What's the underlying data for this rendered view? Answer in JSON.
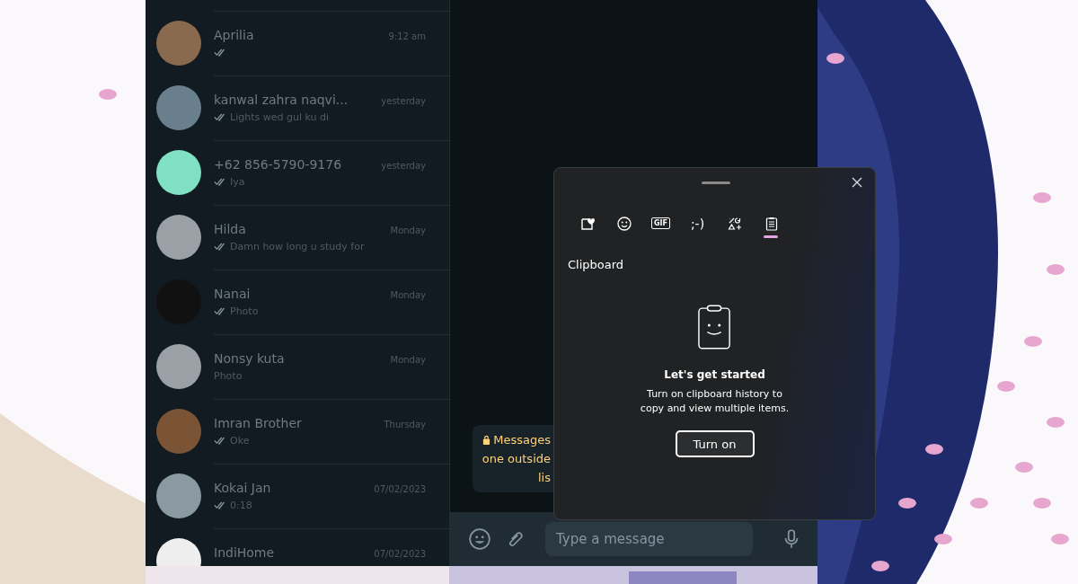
{
  "chats": [
    {
      "name": "Aprilia",
      "time": "9:12 am",
      "ticks": true,
      "color": "#8a6a4e"
    },
    {
      "name": "kanwal zahra naqvi...",
      "time": "yesterday",
      "preview": "Lights wed gul ku di",
      "ticks": true,
      "color": "#6a7f8e"
    },
    {
      "name": "+62 856-5790-9176",
      "time": "yesterday",
      "preview": "Iya",
      "ticks": true,
      "color": "#7fe0c4"
    },
    {
      "name": "Hilda",
      "time": "Monday",
      "preview": "Damn how long u study for",
      "ticks": true,
      "color": "#9aa0a6"
    },
    {
      "name": "Nanai",
      "time": "Monday",
      "preview": "Photo",
      "ticks": true,
      "color": "#111111"
    },
    {
      "name": "Nonsy kuta",
      "time": "Monday",
      "preview": "Photo",
      "ticks": false,
      "color": "#9aa0a6"
    },
    {
      "name": "Imran Brother",
      "time": "Thursday",
      "preview": "Oke",
      "ticks": true,
      "color": "#7a5434"
    },
    {
      "name": "Kokai Jan",
      "time": "07/02/2023",
      "preview": "0:18",
      "ticks": true,
      "color": "#8a9aa0"
    },
    {
      "name": "IndiHome",
      "time": "07/02/2023",
      "ticks": false,
      "color": "#eeeeee"
    }
  ],
  "notice": {
    "lines": [
      "Messages",
      "one outside",
      "lis"
    ]
  },
  "composer": {
    "placeholder": "Type a message"
  },
  "clipboard_panel": {
    "tabs": [
      {
        "kind": "sticker",
        "selected": false
      },
      {
        "kind": "emoji",
        "selected": false
      },
      {
        "kind": "gif",
        "label": "GIF",
        "selected": false
      },
      {
        "kind": "kaomoji",
        "label": ";-)",
        "selected": false
      },
      {
        "kind": "symbols",
        "selected": false
      },
      {
        "kind": "clipboard",
        "selected": true
      }
    ],
    "heading": "Clipboard",
    "title": "Let's get started",
    "message": "Turn on clipboard history to copy and view multiple items.",
    "button": "Turn on"
  }
}
